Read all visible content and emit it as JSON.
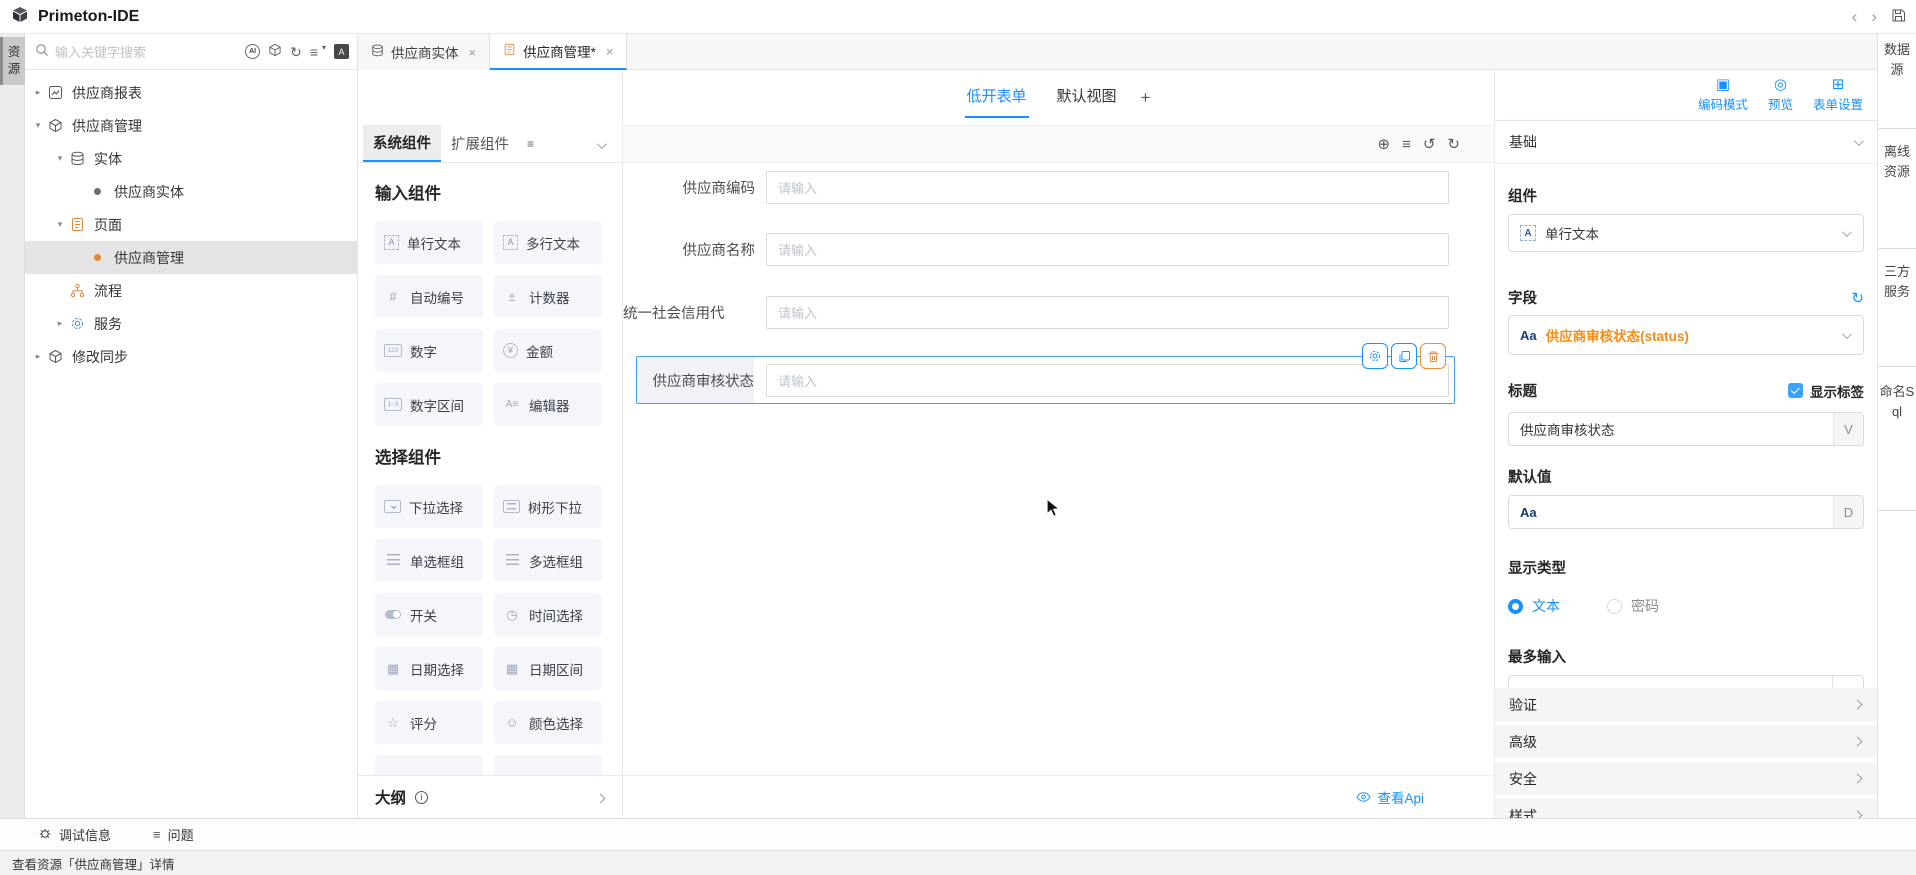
{
  "titlebar": {
    "app_title": "Primeton-IDE",
    "back": "‹",
    "forward": "›"
  },
  "left_rail": {
    "active_tab": "资源"
  },
  "resource_panel": {
    "search_placeholder": "输入关键字搜索",
    "toolbar": {
      "ai": "AI",
      "refresh": "↻",
      "list": "≡",
      "list_caret": "▾",
      "translate": "A"
    },
    "tree": {
      "items": [
        {
          "arrow": "▸",
          "label": "供应商报表"
        },
        {
          "arrow": "▾",
          "label": "供应商管理"
        },
        {
          "arrow": "▾",
          "label": "实体"
        },
        {
          "arrow": "",
          "label": "供应商实体"
        },
        {
          "arrow": "▾",
          "label": "页面"
        },
        {
          "arrow": "",
          "label": "供应商管理"
        },
        {
          "arrow": "",
          "label": "流程"
        },
        {
          "arrow": "▸",
          "label": "服务"
        },
        {
          "arrow": "▸",
          "label": "修改同步"
        }
      ]
    }
  },
  "editor_tabs": {
    "items": [
      {
        "label": "供应商实体",
        "close": "×"
      },
      {
        "label": "供应商管理*",
        "close": "×"
      }
    ]
  },
  "view_tabs": {
    "items": [
      {
        "label": "低开表单"
      },
      {
        "label": "默认视图"
      }
    ],
    "add": "+"
  },
  "header_actions": {
    "items": [
      {
        "label": "编码模式",
        "glyph": "▣"
      },
      {
        "label": "预览",
        "glyph": "◎"
      },
      {
        "label": "表单设置",
        "glyph": "⊞"
      }
    ]
  },
  "palette": {
    "tabs": [
      {
        "label": "系统组件"
      },
      {
        "label": "扩展组件"
      }
    ],
    "menu_glyph": "≡",
    "sections": [
      {
        "title": "输入组件",
        "items": [
          {
            "label": "单行文本",
            "glyph": "A"
          },
          {
            "label": "多行文本",
            "glyph": "A"
          },
          {
            "label": "自动编号",
            "glyph": "#"
          },
          {
            "label": "计数器",
            "glyph": "±"
          },
          {
            "label": "数字",
            "glyph": "123"
          },
          {
            "label": "金额",
            "glyph": "¥"
          },
          {
            "label": "数字区间",
            "glyph": "1~3"
          },
          {
            "label": "编辑器",
            "glyph": "A≡"
          }
        ]
      },
      {
        "title": "选择组件",
        "items": [
          {
            "label": "下拉选择",
            "glyph": ""
          },
          {
            "label": "树形下拉",
            "glyph": ""
          },
          {
            "label": "单选框组",
            "glyph": ""
          },
          {
            "label": "多选框组",
            "glyph": ""
          },
          {
            "label": "开关",
            "glyph": ""
          },
          {
            "label": "时间选择",
            "glyph": "◷"
          },
          {
            "label": "日期选择",
            "glyph": "▦"
          },
          {
            "label": "日期区间",
            "glyph": "▦"
          },
          {
            "label": "评分",
            "glyph": "☆"
          },
          {
            "label": "颜色选择",
            "glyph": "☺"
          }
        ]
      }
    ],
    "outline_label": "大纲"
  },
  "canvas": {
    "toolbar": {
      "globe": "⊕",
      "outline": "≡",
      "undo": "↺",
      "redo": "↻"
    },
    "fields": [
      {
        "label": "供应商编码",
        "placeholder": "请输入"
      },
      {
        "label": "供应商名称",
        "placeholder": "请输入"
      },
      {
        "label": "统一社会信用代",
        "placeholder": "请输入"
      },
      {
        "label": "供应商审核状态",
        "placeholder": "请输入"
      }
    ],
    "api_link": "查看Api"
  },
  "inspector": {
    "header": "基础",
    "component": {
      "label": "组件",
      "icon_letter": "A",
      "value": "单行文本"
    },
    "field": {
      "label": "字段",
      "prefix": "Aa",
      "value": "供应商审核状态(status)",
      "refresh": "↻"
    },
    "title": {
      "label": "标题",
      "checkbox_label": "显示标签",
      "value": "供应商审核状态",
      "suffix": "V"
    },
    "default_value": {
      "label": "默认值",
      "prefix": "Aa",
      "suffix": "D"
    },
    "display_type": {
      "label": "显示类型",
      "option_on": "文本",
      "option_off": "密码"
    },
    "max_input": {
      "label": "最多输入"
    },
    "sections": [
      {
        "label": "验证"
      },
      {
        "label": "高级"
      },
      {
        "label": "安全"
      },
      {
        "label": "样式"
      }
    ]
  },
  "right_rail": {
    "tabs": [
      {
        "label": "数据源"
      },
      {
        "label": "离线资源"
      },
      {
        "label": "三方服务"
      },
      {
        "label": "命名Sql"
      }
    ]
  },
  "bottom_bar": {
    "debug": "调试信息",
    "problems": "问题",
    "problems_glyph": "≡"
  },
  "status_bar": {
    "text": "查看资源「供应商管理」详情"
  },
  "colors": {
    "accent": "#1890ff",
    "orange": "#fa8c16",
    "selection_border": "#41a0ff"
  }
}
